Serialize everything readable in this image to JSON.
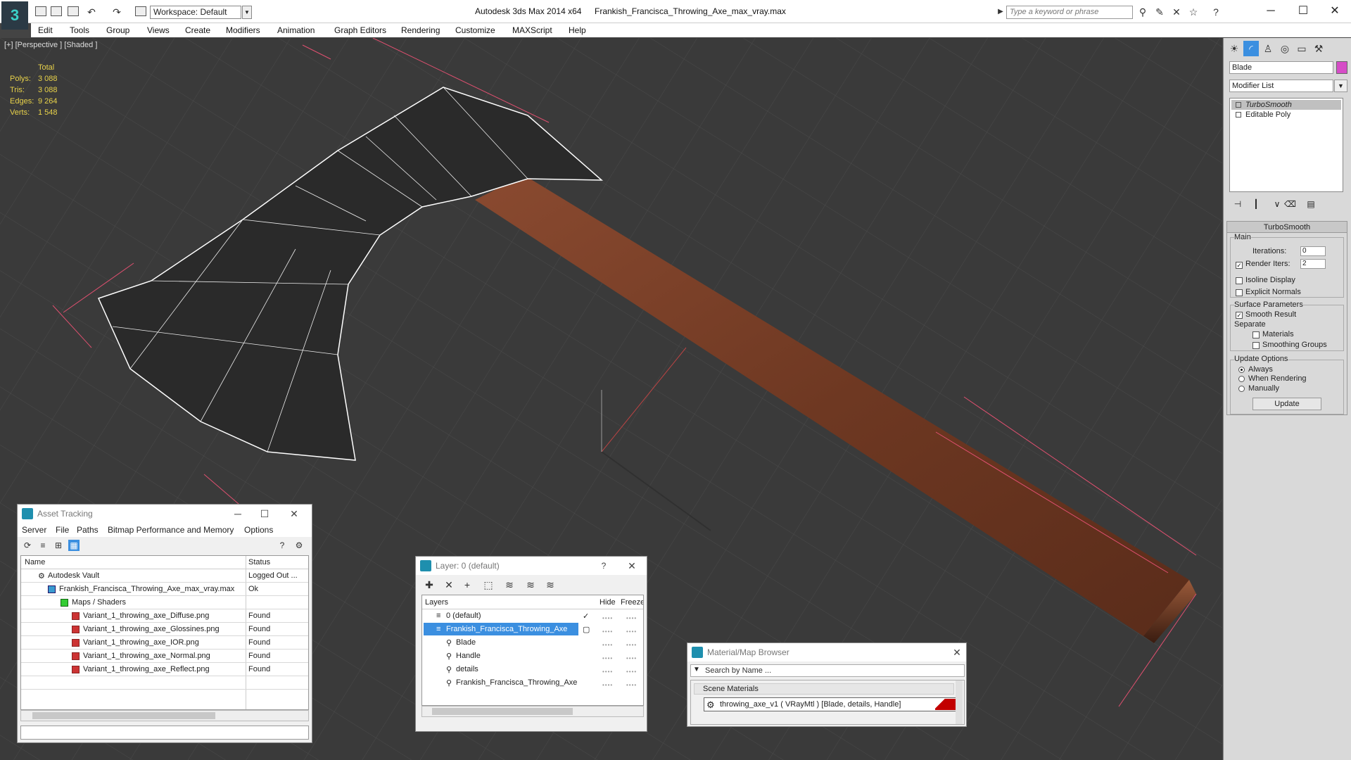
{
  "titlebar": {
    "workspace": "Workspace: Default",
    "app_title": "Autodesk 3ds Max  2014 x64",
    "doc_title": "Frankish_Francisca_Throwing_Axe_max_vray.max",
    "search_placeholder": "Type a keyword or phrase"
  },
  "menu": [
    "Edit",
    "Tools",
    "Group",
    "Views",
    "Create",
    "Modifiers",
    "Animation",
    "Graph Editors",
    "Rendering",
    "Customize",
    "MAXScript",
    "Help"
  ],
  "viewport": {
    "label": "[+] [Perspective ] [Shaded ]",
    "stats_header": "Total",
    "stats": [
      {
        "label": "Polys:",
        "value": "3 088"
      },
      {
        "label": "Tris:",
        "value": "3 088"
      },
      {
        "label": "Edges:",
        "value": "9 264"
      },
      {
        "label": "Verts:",
        "value": "1 548"
      }
    ]
  },
  "command_panel": {
    "object_name": "Blade",
    "object_color": "#d64dc7",
    "modifier_list": "Modifier List",
    "stack": [
      "TurboSmooth",
      "Editable Poly"
    ],
    "rollout_title": "TurboSmooth",
    "main_label": "Main",
    "iterations_label": "Iterations:",
    "iterations_value": "0",
    "render_iters_label": "Render Iters:",
    "render_iters_value": "2",
    "render_iters_checked": true,
    "isoline_label": "Isoline Display",
    "explicit_normals_label": "Explicit Normals",
    "surface_params_label": "Surface Parameters",
    "smooth_result_label": "Smooth Result",
    "smooth_result_checked": true,
    "separate_label": "Separate",
    "materials_label": "Materials",
    "smoothing_groups_label": "Smoothing Groups",
    "update_options_label": "Update Options",
    "always_label": "Always",
    "when_rendering_label": "When Rendering",
    "manually_label": "Manually",
    "update_button": "Update"
  },
  "asset_tracking": {
    "title": "Asset Tracking",
    "menu": [
      "Server",
      "File",
      "Paths",
      "Bitmap Performance and Memory",
      "Options"
    ],
    "col_name": "Name",
    "col_status": "Status",
    "rows": [
      {
        "name": "Autodesk Vault",
        "status": "Logged Out ...",
        "indent": 0
      },
      {
        "name": "Frankish_Francisca_Throwing_Axe_max_vray.max",
        "status": "Ok",
        "indent": 1
      },
      {
        "name": "Maps / Shaders",
        "status": "",
        "indent": 2
      },
      {
        "name": "Variant_1_throwing_axe_Diffuse.png",
        "status": "Found",
        "indent": 3
      },
      {
        "name": "Variant_1_throwing_axe_Glossines.png",
        "status": "Found",
        "indent": 3
      },
      {
        "name": "Variant_1_throwing_axe_IOR.png",
        "status": "Found",
        "indent": 3
      },
      {
        "name": "Variant_1_throwing_axe_Normal.png",
        "status": "Found",
        "indent": 3
      },
      {
        "name": "Variant_1_throwing_axe_Reflect.png",
        "status": "Found",
        "indent": 3
      }
    ]
  },
  "layer_window": {
    "title": "Layer: 0 (default)",
    "help": "?",
    "col_layers": "Layers",
    "col_hide": "Hide",
    "col_freeze": "Freeze",
    "rows": [
      {
        "name": "0 (default)",
        "indent": 0
      },
      {
        "name": "Frankish_Francisca_Throwing_Axe",
        "indent": 0
      },
      {
        "name": "Blade",
        "indent": 1
      },
      {
        "name": "Handle",
        "indent": 1
      },
      {
        "name": "details",
        "indent": 1
      },
      {
        "name": "Frankish_Francisca_Throwing_Axe",
        "indent": 1
      }
    ]
  },
  "material_browser": {
    "title": "Material/Map Browser",
    "search_placeholder": "Search by Name ...",
    "section": "Scene Materials",
    "item": "throwing_axe_v1  ( VRayMtl ) [Blade, details, Handle]"
  }
}
